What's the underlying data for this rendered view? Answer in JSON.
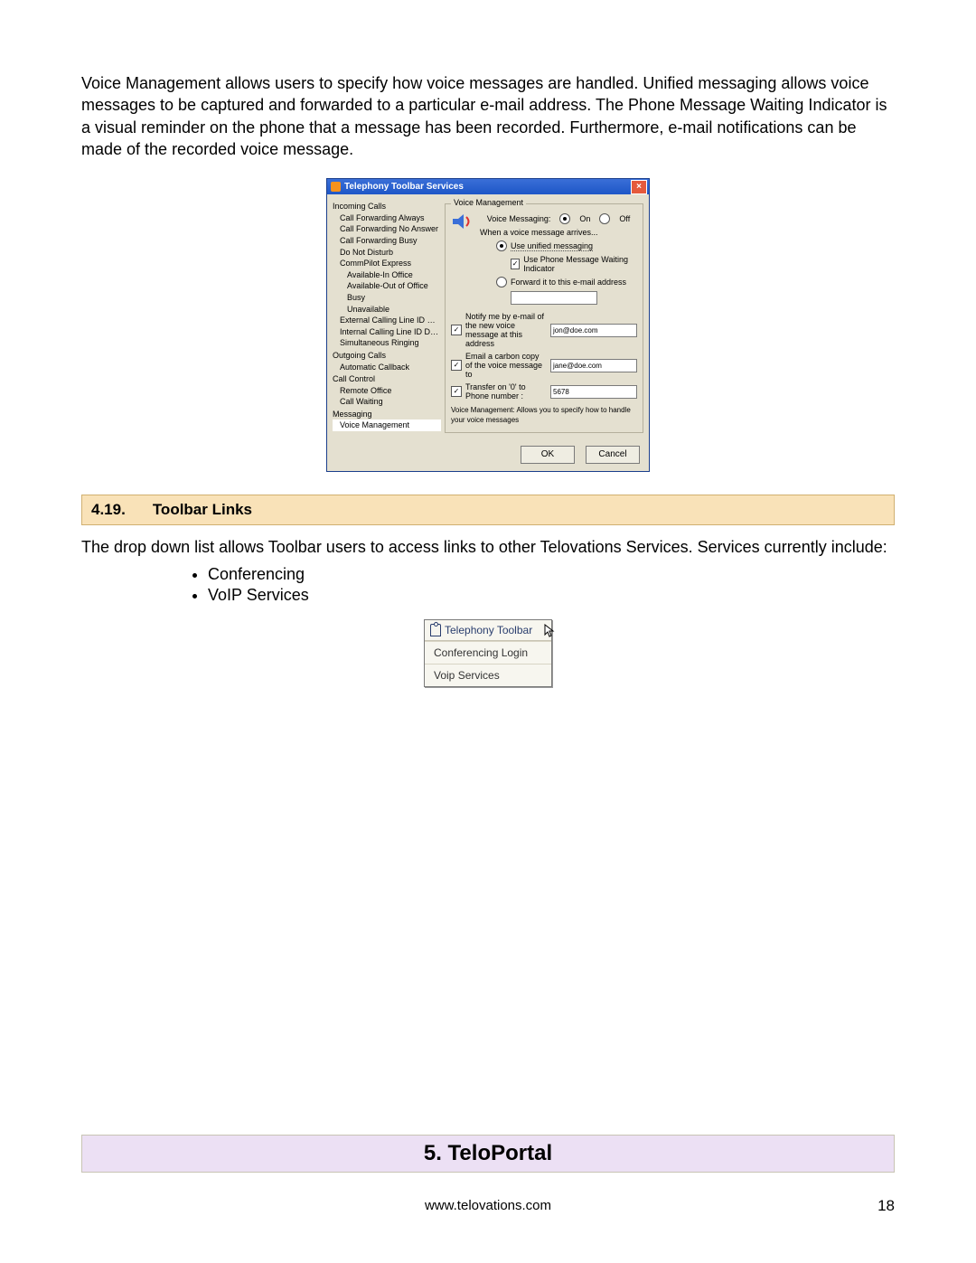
{
  "intro_paragraph": "Voice Management allows users to specify how voice messages are handled. Unified messaging allows voice messages to be captured and forwarded to a particular e-mail address. The Phone Message Waiting Indicator is a visual reminder on the phone that a message has been recorded. Furthermore, e-mail notifications can be made of the recorded voice message.",
  "dialog": {
    "title": "Telephony Toolbar Services",
    "tree": {
      "groups": [
        {
          "label": "Incoming Calls",
          "items": [
            "Call Forwarding Always",
            "Call Forwarding No Answer",
            "Call Forwarding Busy",
            "Do Not Disturb",
            "CommPilot Express"
          ],
          "sub": [
            "Available-In Office",
            "Available-Out of Office",
            "Busy",
            "Unavailable"
          ],
          "items2": [
            "External Calling Line ID Delivery",
            "Internal Calling Line ID Delivery",
            "Simultaneous Ringing"
          ]
        },
        {
          "label": "Outgoing Calls",
          "items": [
            "Automatic Callback"
          ]
        },
        {
          "label": "Call Control",
          "items": [
            "Remote Office",
            "Call Waiting"
          ]
        },
        {
          "label": "Messaging",
          "items": [
            "Voice Management"
          ]
        }
      ]
    },
    "panel": {
      "legend": "Voice Management",
      "voice_messaging_label": "Voice Messaging:",
      "on_label": "On",
      "off_label": "Off",
      "arrive_label": "When a voice message arrives...",
      "use_unified_label": "Use unified messaging",
      "use_pmwi_label": "Use Phone Message Waiting Indicator",
      "forward_email_label": "Forward it to this e-mail address",
      "notify_label": "Notify me by e-mail of the new voice message at this address",
      "notify_value": "jon@doe.com",
      "carbon_label": "Email a carbon copy of the voice message to",
      "carbon_value": "jane@doe.com",
      "transfer_label": "Transfer on '0' to Phone number :",
      "transfer_value": "5678",
      "description": "Voice Management: Allows you to specify how to handle your voice messages"
    },
    "buttons": {
      "ok": "OK",
      "cancel": "Cancel"
    }
  },
  "section_419": {
    "num": "4.19.",
    "title": "Toolbar Links"
  },
  "toolbar_links_text": "The drop down list allows Toolbar users to access links to other Telovations Services.  Services currently include:",
  "bullets": [
    "Conferencing",
    "VoIP Services"
  ],
  "dropdown": {
    "title": "Telephony Toolbar",
    "items": [
      "Conferencing Login",
      "Voip Services"
    ]
  },
  "section_5": {
    "title": "5. TeloPortal"
  },
  "footer": {
    "url": "www.telovations.com",
    "page": "18"
  }
}
